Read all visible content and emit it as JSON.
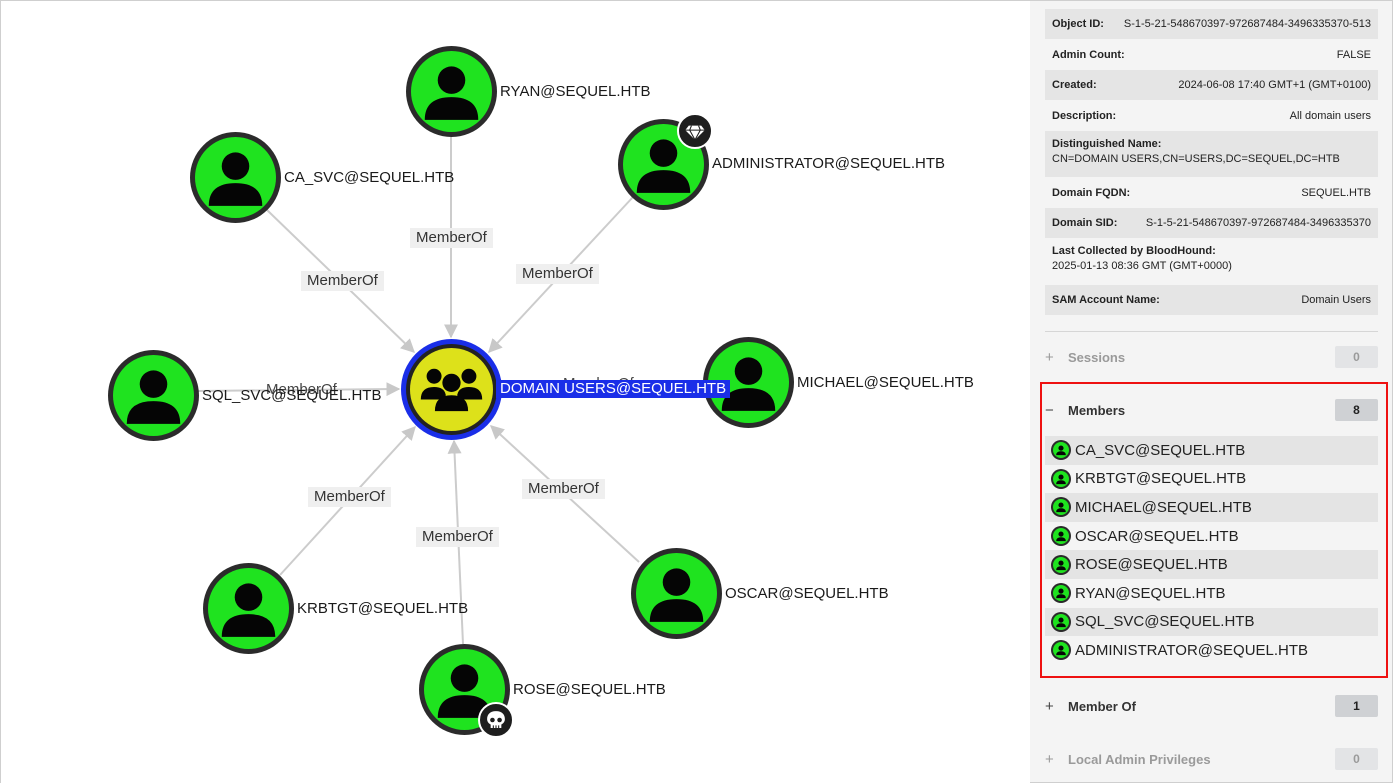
{
  "graph": {
    "center_node": {
      "label": "DOMAIN USERS@SEQUEL.HTB",
      "icon": "group-icon",
      "color": "#dde11a",
      "ring_color": "#1a2ee8"
    },
    "edge_label": "MemberOf",
    "overlap_text": "MemberOf",
    "nodes": [
      {
        "label": "RYAN@SEQUEL.HTB",
        "icon": "user-icon"
      },
      {
        "label": "CA_SVC@SEQUEL.HTB",
        "icon": "user-icon"
      },
      {
        "label": "ADMINISTRATOR@SEQUEL.HTB",
        "icon": "user-icon",
        "badge": "diamond-icon"
      },
      {
        "label": "SQL_SVC@SEQUEL.HTB",
        "icon": "user-icon"
      },
      {
        "label": "MICHAEL@SEQUEL.HTB",
        "icon": "user-icon"
      },
      {
        "label": "KRBTGT@SEQUEL.HTB",
        "icon": "user-icon"
      },
      {
        "label": "OSCAR@SEQUEL.HTB",
        "icon": "user-icon"
      },
      {
        "label": "ROSE@SEQUEL.HTB",
        "icon": "user-icon",
        "badge": "skull-icon"
      }
    ],
    "node_color": "#1fe31f"
  },
  "properties": [
    {
      "key": "Object ID:",
      "value": "S-1-5-21-548670397-972687484-3496335370-513"
    },
    {
      "key": "Admin Count:",
      "value": "FALSE"
    },
    {
      "key": "Created:",
      "value": "2024-06-08 17:40 GMT+1 (GMT+0100)"
    },
    {
      "key": "Description:",
      "value": "All domain users"
    },
    {
      "key": "Distinguished Name:",
      "value": "CN=DOMAIN USERS,CN=USERS,DC=SEQUEL,DC=HTB"
    },
    {
      "key": "Domain FQDN:",
      "value": "SEQUEL.HTB"
    },
    {
      "key": "Domain SID:",
      "value": "S-1-5-21-548670397-972687484-3496335370"
    },
    {
      "key": "Last Collected by BloodHound:",
      "value": "2025-01-13 08:36 GMT (GMT+0000)"
    },
    {
      "key": "SAM Account Name:",
      "value": "Domain Users"
    }
  ],
  "sections": {
    "sessions": {
      "toggle": "+",
      "title": "Sessions",
      "count": "0"
    },
    "members": {
      "toggle": "−",
      "title": "Members",
      "count": "8"
    },
    "member_of": {
      "toggle": "+",
      "title": "Member Of",
      "count": "1"
    },
    "local_admin": {
      "toggle": "+",
      "title": "Local Admin Privileges",
      "count": "0"
    }
  },
  "members": [
    "CA_SVC@SEQUEL.HTB",
    "KRBTGT@SEQUEL.HTB",
    "MICHAEL@SEQUEL.HTB",
    "OSCAR@SEQUEL.HTB",
    "ROSE@SEQUEL.HTB",
    "RYAN@SEQUEL.HTB",
    "SQL_SVC@SEQUEL.HTB",
    "ADMINISTRATOR@SEQUEL.HTB"
  ],
  "colors": {
    "highlight_border": "#ee1111",
    "user_node": "#1fe31f",
    "group_node": "#dde11a",
    "selected": "#1a2ee8"
  }
}
